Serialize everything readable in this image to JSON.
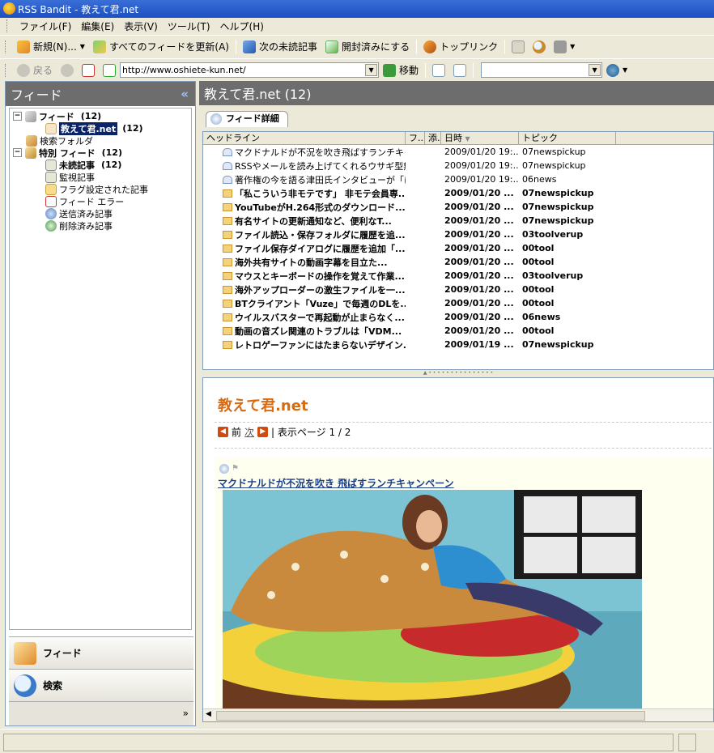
{
  "window": {
    "title": "RSS Bandit - 教えて君.net"
  },
  "menu": [
    "ファイル(F)",
    "編集(E)",
    "表示(V)",
    "ツール(T)",
    "ヘルプ(H)"
  ],
  "toolbar": {
    "new_label": "新規(N)...",
    "refresh_all_label": "すべてのフィードを更新(A)",
    "next_unread_label": "次の未読記事",
    "mark_read_label": "開封済みにする",
    "top_stories_label": "トップリンク"
  },
  "nav": {
    "back_label": "戻る",
    "url": "http://www.oshiete-kun.net/",
    "go_label": "移動",
    "search_value": ""
  },
  "left": {
    "header": "フィード",
    "collapse_glyph": "«",
    "tree": {
      "feeds_label": "フィード",
      "feeds_count": "(12)",
      "site_label": "教えて君.net",
      "site_count": "(12)",
      "search_folder": "検索フォルダ",
      "special_label": "特別 フィード",
      "special_count": "(12)",
      "unread_label": "未読記事",
      "unread_count": "(12)",
      "watched_label": "監視記事",
      "flagged_label": "フラグ設定された記事",
      "errors_label": "フィード エラー",
      "sent_label": "送信済み記事",
      "deleted_label": "削除済み記事"
    },
    "nav_buttons": {
      "feeds": "フィード",
      "search": "検索"
    },
    "more_glyph": "»"
  },
  "right": {
    "header": "教えて君.net (12)",
    "tab_label": "フィード詳細",
    "columns": {
      "headline": "ヘッドライン",
      "flag": "フ...",
      "attach": "添...",
      "date": "日時",
      "topic": "トピック"
    },
    "items": [
      {
        "headline": "マクドナルドが不況を吹き飛ばすランチキャ...",
        "date": "2009/01/20 19:...",
        "topic": "07newspickup",
        "unread": false
      },
      {
        "headline": "RSSやメールを読み上げてくれるウサギ型無...",
        "date": "2009/01/20 19:...",
        "topic": "07newspickup",
        "unread": false
      },
      {
        "headline": "著作権の今を語る津田氏インタビューが「は...",
        "date": "2009/01/20 19:...",
        "topic": "06news",
        "unread": false
      },
      {
        "headline": "「私こういう非モテです」 非モテ会員専...",
        "date": "2009/01/20 ...",
        "topic": "07newspickup",
        "unread": true
      },
      {
        "headline": "YouTubeがH.264形式のダウンロード...",
        "date": "2009/01/20 ...",
        "topic": "07newspickup",
        "unread": true
      },
      {
        "headline": "有名サイトの更新通知など、便利なT...",
        "date": "2009/01/20 ...",
        "topic": "07newspickup",
        "unread": true
      },
      {
        "headline": "ファイル読込・保存フォルダに履歴を追...",
        "date": "2009/01/20 ...",
        "topic": "03toolverup",
        "unread": true
      },
      {
        "headline": "ファイル保存ダイアログに履歴を追加「...",
        "date": "2009/01/20 ...",
        "topic": "00tool",
        "unread": true
      },
      {
        "headline": "海外共有サイトの動画字幕を目立た...",
        "date": "2009/01/20 ...",
        "topic": "00tool",
        "unread": true
      },
      {
        "headline": "マウスとキーボードの操作を覚えて作業...",
        "date": "2009/01/20 ...",
        "topic": "03toolverup",
        "unread": true
      },
      {
        "headline": "海外アップローダーの激生ファイルを一...",
        "date": "2009/01/20 ...",
        "topic": "00tool",
        "unread": true
      },
      {
        "headline": "BTクライアント「Vuze」で毎週のDLを...",
        "date": "2009/01/20 ...",
        "topic": "00tool",
        "unread": true
      },
      {
        "headline": "ウイルスバスターで再起動が止まらなく...",
        "date": "2009/01/20 ...",
        "topic": "06news",
        "unread": true
      },
      {
        "headline": "動画の音ズレ関連のトラブルは「VDM...",
        "date": "2009/01/20 ...",
        "topic": "00tool",
        "unread": true
      },
      {
        "headline": "レトロゲーファンにはたまらないデザイン...",
        "date": "2009/01/19 ...",
        "topic": "07newspickup",
        "unread": true
      }
    ],
    "preview": {
      "site_title": "教えて君.net",
      "prev_label": "前",
      "next_label": "次",
      "page_label": "| 表示ページ 1 / 2",
      "article_title": "マクドナルドが不況を吹き 飛ばすランチキャンペーン"
    }
  },
  "colors": {
    "accent": "#d86a10",
    "selection": "#0a246a",
    "header_gray": "#6d6d6d"
  }
}
